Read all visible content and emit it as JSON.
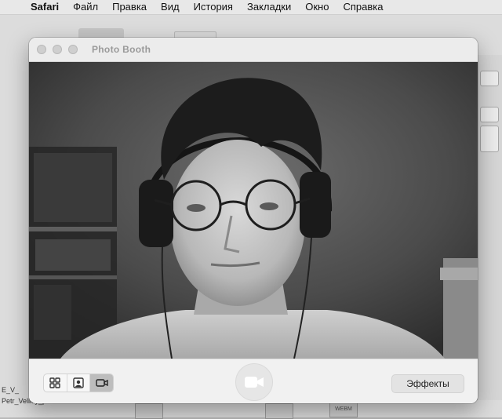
{
  "menubar": {
    "app_name": "Safari",
    "items": [
      "Файл",
      "Правка",
      "Вид",
      "История",
      "Закладки",
      "Окно",
      "Справка"
    ]
  },
  "window": {
    "title": "Photo Booth",
    "traffic_lights": [
      "close",
      "minimize",
      "zoom"
    ]
  },
  "toolbar": {
    "view_modes": [
      {
        "icon": "grid-four-icon",
        "active": false
      },
      {
        "icon": "portrait-photo-icon",
        "active": false
      },
      {
        "icon": "video-camera-icon",
        "active": true
      }
    ],
    "shutter_icon": "video-camera-icon",
    "effects_label": "Эффекты"
  },
  "background": {
    "labels": [
      "E_V_",
      "Petr_Velikiy_p"
    ],
    "thumb_label": "WEBM"
  },
  "colors": {
    "window_bg": "#f3f3f3",
    "toolbar_bg": "#f1f1f1",
    "active_segment": "#bdbdbd",
    "camera_tone": "grayscale"
  }
}
